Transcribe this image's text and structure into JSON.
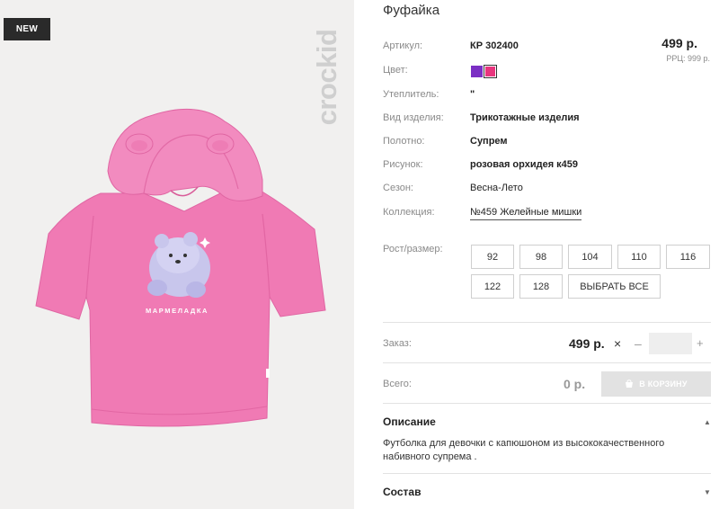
{
  "badge": "NEW",
  "brand": "crockid",
  "print_text": "МАРМЕЛАДКА",
  "product": {
    "title": "Фуфайка"
  },
  "attributes": {
    "article_label": "Артикул:",
    "article_value": "КР 302400",
    "color_label": "Цвет:",
    "insulation_label": "Утеплитель:",
    "insulation_value": "\"",
    "type_label": "Вид изделия:",
    "type_value": "Трикотажные изделия",
    "fabric_label": "Полотно:",
    "fabric_value": "Супрем",
    "pattern_label": "Рисунок:",
    "pattern_value": "розовая орхидея к459",
    "season_label": "Сезон:",
    "season_value": "Весна-Лето",
    "collection_label": "Коллекция:",
    "collection_value": "№459 Желейные мишки"
  },
  "colors": [
    "#7b2fc4",
    "#e8357d"
  ],
  "price": {
    "main": "499 р.",
    "rrp": "РРЦ: 999 р."
  },
  "sizes": {
    "label": "Рост/размер:",
    "options": [
      "92",
      "98",
      "104",
      "110",
      "116",
      "122",
      "128"
    ],
    "select_all": "ВЫБРАТЬ ВСЕ"
  },
  "order": {
    "label": "Заказ:",
    "price": "499 р.",
    "remove_icon": "×",
    "minus": "–",
    "plus": "+",
    "quantity": ""
  },
  "total": {
    "label": "Всего:",
    "value": "0 р.",
    "cart_button": "В КОРЗИНУ"
  },
  "description": {
    "title": "Описание",
    "text": "Футболка для девочки с капюшоном из высококачественного набивного супрема ."
  },
  "composition": {
    "title": "Состав"
  }
}
